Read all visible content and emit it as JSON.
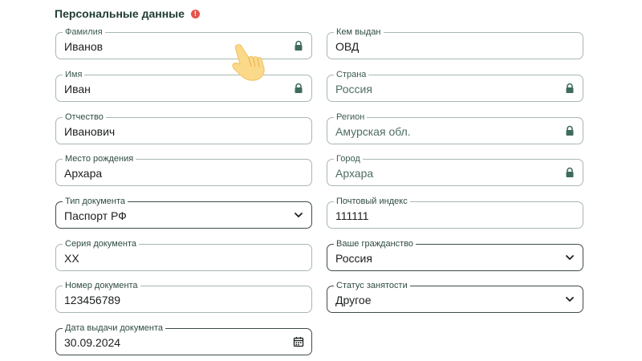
{
  "section": {
    "title": "Персональные данные",
    "alert_glyph": "!"
  },
  "colors": {
    "accent": "#3f6b5e",
    "alert": "#e5534b",
    "border": "#a7b8b1"
  },
  "left_fields": [
    {
      "label": "Фамилия",
      "value": "Иванов",
      "icon": "lock-icon"
    },
    {
      "label": "Имя",
      "value": "Иван",
      "icon": "lock-icon"
    },
    {
      "label": "Отчество",
      "value": "Иванович"
    },
    {
      "label": "Место рождения",
      "value": "Архара"
    },
    {
      "label": "Тип документа",
      "value": "Паспорт РФ",
      "icon": "chevron-down-icon"
    },
    {
      "label": "Серия документа",
      "value": "XX"
    },
    {
      "label": "Номер документа",
      "value": "123456789"
    },
    {
      "label": "Дата выдачи документа",
      "value": "30.09.2024",
      "icon": "calendar-icon"
    }
  ],
  "right_fields": [
    {
      "label": "Кем выдан",
      "value": "ОВД"
    },
    {
      "label": "Страна",
      "value": "Россия",
      "icon": "lock-icon"
    },
    {
      "label": "Регион",
      "value": "Амурская обл.",
      "icon": "lock-icon"
    },
    {
      "label": "Город",
      "value": "Архара",
      "icon": "lock-icon"
    },
    {
      "label": "Почтовый индекс",
      "value": "111111"
    },
    {
      "label": "Ваше гражданство",
      "value": "Россия",
      "icon": "chevron-down-icon"
    },
    {
      "label": "Статус занятости",
      "value": "Другое",
      "icon": "chevron-down-icon"
    }
  ],
  "cursor": {
    "icon": "pointer-hand-icon"
  }
}
